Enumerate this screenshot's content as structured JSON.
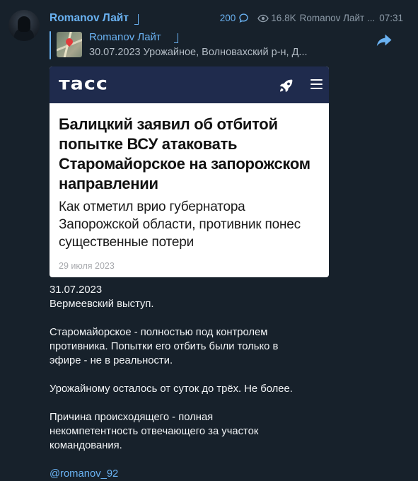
{
  "header": {
    "channel_name": "Romanov Лайт",
    "comments_count": "200",
    "views": "16.8K",
    "author": "Romanov Лайт ...",
    "time": "07:31"
  },
  "reply": {
    "name": "Romanov Лайт",
    "text": "30.07.2023 Урожайное, Волновахский р-н, Д..."
  },
  "card": {
    "logo": "тасс",
    "headline": "Балицкий заявил об отбитой попытке ВСУ атаковать Старомайорское на запорожском направлении",
    "lead": "Как отметил врио губернатора Запорожской области, противник понес существенные потери",
    "date": "29 июля 2023"
  },
  "message": {
    "p1": "31.07.2023\nВермеевский выступ.",
    "p2": "Старомайорское - полностью под контролем\nпротивника. Попытки его отбить были только в\nэфире - не в реальности.",
    "p3": "Урожайному осталось от суток до трёх. Не более.",
    "p4": "Причина происходящего - полная\nнекомпетентность отвечающего за участок\nкомандования.",
    "mention": "@romanov_92"
  },
  "colors": {
    "background": "#17212b",
    "accent": "#6ab2f2",
    "meta_text": "#8d9ba8",
    "card_topbar": "#1f2b4d"
  },
  "icons": {
    "comments": "speech-bubble-icon",
    "views": "eye-icon",
    "share": "share-arrow-icon",
    "rocket": "rocket-icon",
    "menu": "hamburger-menu-icon"
  }
}
